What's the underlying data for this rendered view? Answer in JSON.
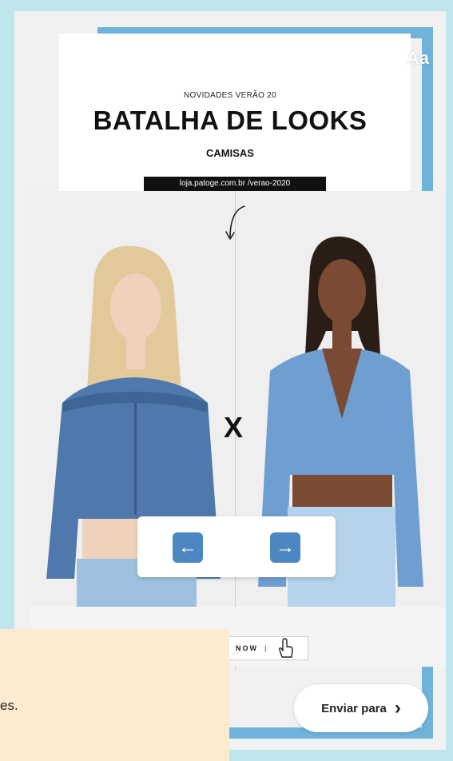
{
  "story": {
    "subtitle": "NOVIDADES VERÃO 20",
    "title": "BATALHA DE LOOKS",
    "category": "CAMISAS",
    "url": "loja.patoge.com.br /verao-2020",
    "vs_mark": "X",
    "shop_now": "NOW"
  },
  "toolbar": {
    "items": [
      "close-icon",
      "download-icon",
      "face-effects-icon",
      "link-icon",
      "sticker-icon",
      "sound-icon",
      "draw-icon"
    ],
    "text_tool_label": "Aa"
  },
  "navigation": {
    "prev_symbol": "←",
    "next_symbol": "→"
  },
  "send": {
    "label": "Enviar para",
    "chevron": "›"
  },
  "overlay": {
    "caption": "es."
  },
  "colors": {
    "frame_blue": "#6fb3da",
    "nav_button_blue": "#4d87c2",
    "page_background": "#bfe6ec",
    "caption_background": "#fdebd0"
  }
}
